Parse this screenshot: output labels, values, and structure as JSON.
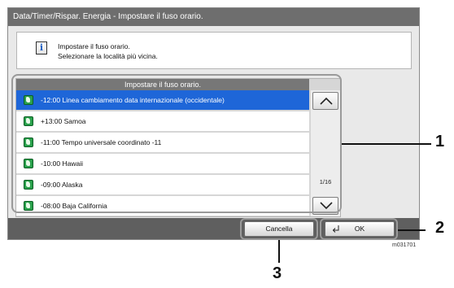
{
  "window": {
    "title": "Data/Timer/Rispar. Energia - Impostare il fuso orario."
  },
  "info": {
    "icon": "info-icon",
    "line1": "Impostare il fuso orario.",
    "line2": "Selezionare la località più vicina."
  },
  "list": {
    "header": "Impostare il fuso orario.",
    "items": [
      {
        "label": "-12:00 Linea cambiamento data internazionale (occidentale)",
        "selected": true
      },
      {
        "label": "+13:00 Samoa",
        "selected": false
      },
      {
        "label": "-11:00 Tempo universale coordinato -11",
        "selected": false
      },
      {
        "label": "-10:00 Hawaii",
        "selected": false
      },
      {
        "label": "-09:00 Alaska",
        "selected": false
      },
      {
        "label": "-08:00 Baja California",
        "selected": false
      }
    ],
    "page_indicator": "1/16"
  },
  "footer": {
    "cancel_label": "Cancella",
    "ok_label": "OK"
  },
  "callouts": {
    "one": "1",
    "two": "2",
    "three": "3"
  },
  "figure_code": "m031701",
  "colors": {
    "selection": "#1e66d8",
    "titlebar": "#6e6e6e",
    "footer": "#5f5f5f"
  }
}
